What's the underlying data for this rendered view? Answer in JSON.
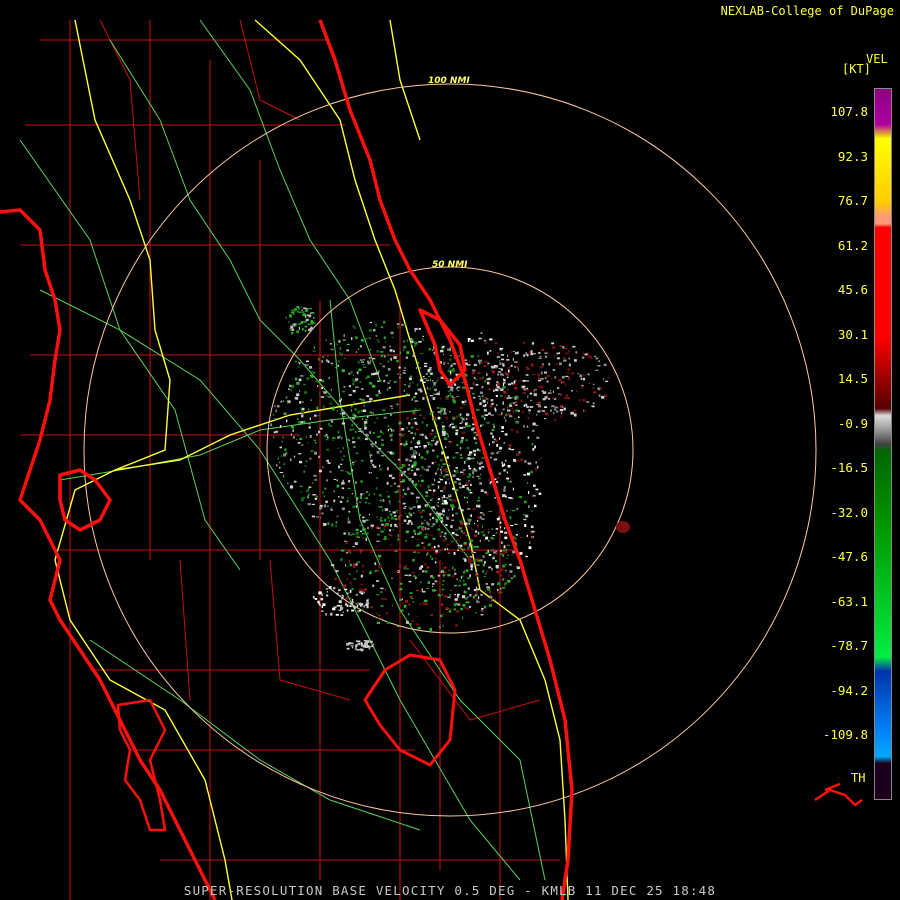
{
  "brand": "NEXLAB-College of DuPage",
  "colorbar": {
    "product": "VEL",
    "unit": "[KT]",
    "ticks": [
      "107.8",
      "92.3",
      "76.7",
      "61.2",
      "45.6",
      "30.1",
      "14.5",
      "-0.9",
      "-16.5",
      "-32.0",
      "-47.6",
      "-63.1",
      "-78.7",
      "-94.2",
      "-109.8"
    ],
    "th_label": "TH"
  },
  "range_rings": [
    "100 NMI",
    "50 NMI"
  ],
  "footer": "SUPER-RESOLUTION BASE VELOCITY 0.5 DEG - KMLB 11 DEC 25 18:48",
  "colors": {
    "state_outline": "#ff0000",
    "county_lines": "#cc1111",
    "highways": "#ffff33",
    "roads": "#66dd66",
    "range_rings": "#ffc8a0"
  }
}
